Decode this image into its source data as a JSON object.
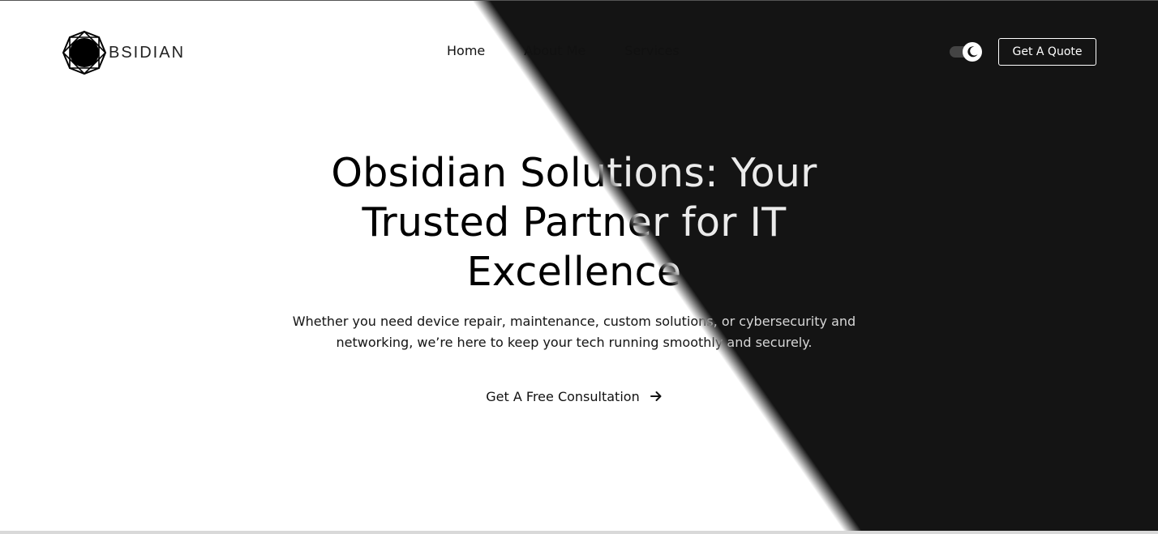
{
  "header": {
    "logo_text": "BSIDIAN",
    "nav": [
      {
        "label": "Home"
      },
      {
        "label": "About Me"
      },
      {
        "label": "Services"
      }
    ],
    "theme_toggle_icon": "moon-icon",
    "quote_button": "Get A Quote"
  },
  "hero": {
    "title": "Obsidian Solutions: Your Trusted Partner for IT Excellence",
    "subtitle": "Whether you need device repair, maintenance, custom solutions, or cybersecurity and networking, we’re here to keep your tech running smoothly and securely.",
    "cta_label": "Get A Free Consultation",
    "cta_icon": "arrow-right-icon"
  },
  "colors": {
    "light_bg": "#ffffff",
    "dark_bg": "#141414",
    "text_dark": "#111111"
  }
}
